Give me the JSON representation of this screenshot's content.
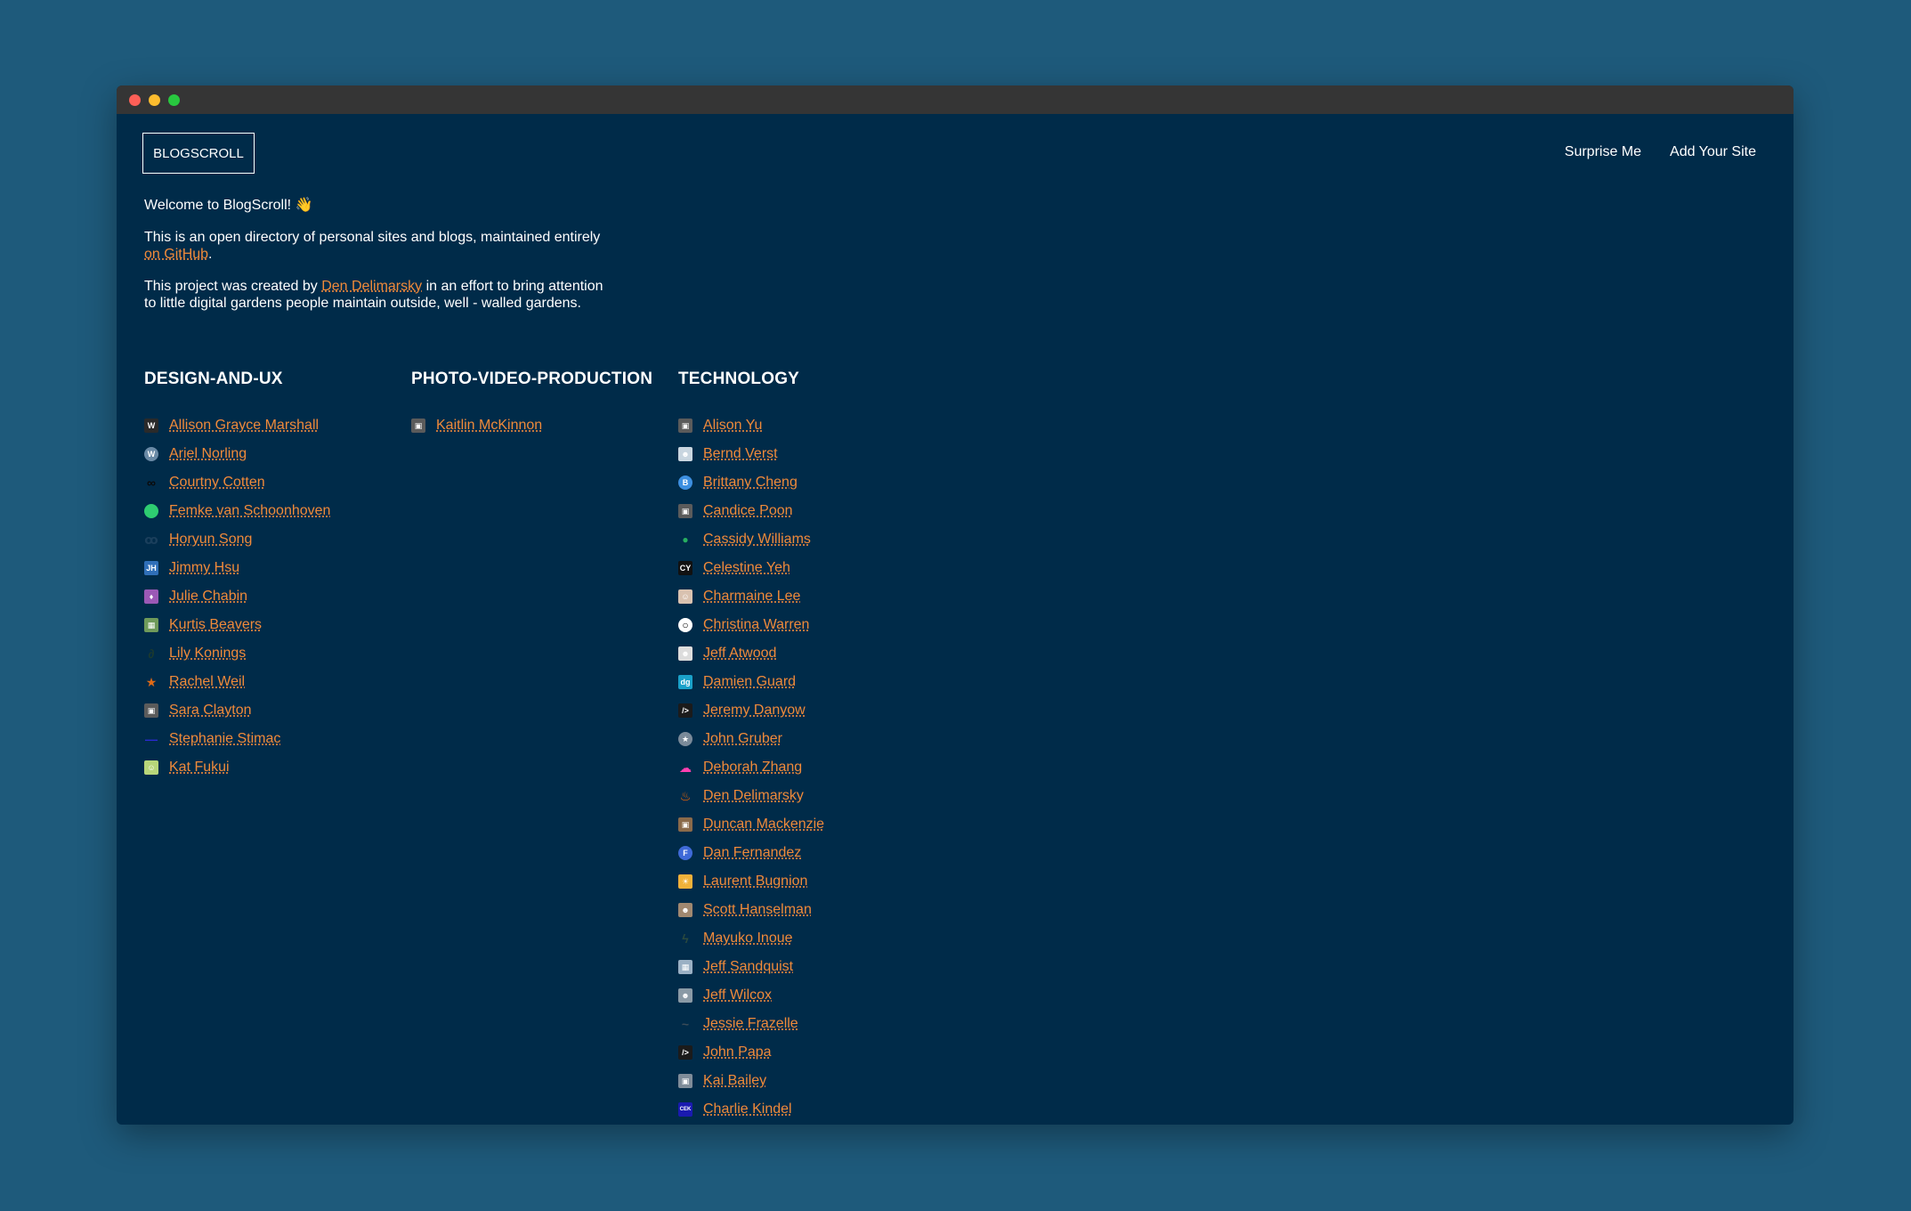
{
  "site": {
    "logo": "BLOGSCROLL",
    "nav": [
      {
        "label": "Surprise Me"
      },
      {
        "label": "Add Your Site"
      }
    ]
  },
  "intro": {
    "welcome": "Welcome to BlogScroll! 👋",
    "p1_text": "This is an open directory of personal sites and blogs, maintained entirely ",
    "p1_link": "on GitHub",
    "p1_end": ".",
    "p2_text": "This project was created by ",
    "p2_link": "Den Delimarsky",
    "p2_end": " in an effort to bring attention to little digital gardens people maintain outside, well - walled gardens."
  },
  "categories": [
    {
      "title": "DESIGN-AND-UX",
      "items": [
        {
          "name": "Allison Grayce Marshall",
          "icon": "w-letter-icon",
          "color": "#2a2a2a",
          "glyph": "W"
        },
        {
          "name": "Ariel Norling",
          "icon": "wordpress-icon",
          "color": "#6a8aa6",
          "glyph": "W"
        },
        {
          "name": "Courtny Cotten",
          "icon": "infinity-icon",
          "color": "#0a0a0a",
          "glyph": "∞"
        },
        {
          "name": "Femke van Schoonhoven",
          "icon": "green-circle-icon",
          "color": "#2ecc71",
          "glyph": ""
        },
        {
          "name": "Horyun Song",
          "icon": "link-glyph-icon",
          "color": "#1a3f5c",
          "glyph": "ꝏ"
        },
        {
          "name": "Jimmy Hsu",
          "icon": "jh-letters-icon",
          "color": "#2f6fb8",
          "glyph": "JH"
        },
        {
          "name": "Julie Chabin",
          "icon": "purple-flame-icon",
          "color": "#9b59b6",
          "glyph": "♦"
        },
        {
          "name": "Kurtis Beavers",
          "icon": "map-icon",
          "color": "#6f9a5a",
          "glyph": "▦"
        },
        {
          "name": "Lily Konings",
          "icon": "swirl-icon",
          "color": "#1c3a2e",
          "glyph": "∂"
        },
        {
          "name": "Rachel Weil",
          "icon": "star-icon",
          "color": "#e06a16",
          "glyph": "★"
        },
        {
          "name": "Sara Clayton",
          "icon": "cube-icon",
          "color": "#5b5b5b",
          "glyph": "▣"
        },
        {
          "name": "Stephanie Stimac",
          "icon": "blue-dash-icon",
          "color": "#2a2ad0",
          "glyph": "—"
        },
        {
          "name": "Kat Fukui",
          "icon": "smiley-icon",
          "color": "#b8d67a",
          "glyph": "☺"
        }
      ]
    },
    {
      "title": "PHOTO-VIDEO-PRODUCTION",
      "items": [
        {
          "name": "Kaitlin McKinnon",
          "icon": "cube-icon",
          "color": "#5b5b5b",
          "glyph": "▣"
        }
      ]
    },
    {
      "title": "TECHNOLOGY",
      "items": [
        {
          "name": "Alison Yu",
          "icon": "cube-icon",
          "color": "#5b5b5b",
          "glyph": "▣"
        },
        {
          "name": "Bernd Verst",
          "icon": "portrait-icon",
          "color": "#c9d6e0",
          "glyph": "☻"
        },
        {
          "name": "Brittany Cheng",
          "icon": "blue-b-icon",
          "color": "#3d8fe0",
          "glyph": "B"
        },
        {
          "name": "Candice Poon",
          "icon": "cube-icon",
          "color": "#5b5b5b",
          "glyph": "▣"
        },
        {
          "name": "Cassidy Williams",
          "icon": "green-dot-icon",
          "color": "#27ae60",
          "glyph": "●"
        },
        {
          "name": "Celestine Yeh",
          "icon": "cy-letters-icon",
          "color": "#111111",
          "glyph": "CY"
        },
        {
          "name": "Charmaine Lee",
          "icon": "people-icon",
          "color": "#d9c2b0",
          "glyph": "☺"
        },
        {
          "name": "Christina Warren",
          "icon": "ring-icon",
          "color": "#000000",
          "glyph": "○"
        },
        {
          "name": "Jeff Atwood",
          "icon": "portrait-icon",
          "color": "#dddddd",
          "glyph": "☻"
        },
        {
          "name": "Damien Guard",
          "icon": "dg-letters-icon",
          "color": "#1aa1c9",
          "glyph": "dg"
        },
        {
          "name": "Jeremy Danyow",
          "icon": "code-icon",
          "color": "#1b1b1b",
          "glyph": "/>"
        },
        {
          "name": "John Gruber",
          "icon": "star-badge-icon",
          "color": "#7a8a99",
          "glyph": "★"
        },
        {
          "name": "Deborah Zhang",
          "icon": "pink-cloud-icon",
          "color": "#ff3fb0",
          "glyph": "☁"
        },
        {
          "name": "Den Delimarsky",
          "icon": "fire-icon",
          "color": "#ff6a00",
          "glyph": "♨"
        },
        {
          "name": "Duncan Mackenzie",
          "icon": "photo-icon",
          "color": "#8a6a4a",
          "glyph": "▣"
        },
        {
          "name": "Dan Fernandez",
          "icon": "f-letter-icon",
          "color": "#3f6ad8",
          "glyph": "F"
        },
        {
          "name": "Laurent Bugnion",
          "icon": "sun-icon",
          "color": "#f0b13a",
          "glyph": "☀"
        },
        {
          "name": "Scott Hanselman",
          "icon": "face-icon",
          "color": "#a08870",
          "glyph": "☻"
        },
        {
          "name": "Mayuko Inoue",
          "icon": "leaf-icon",
          "color": "#2b4a3e",
          "glyph": "ϟ"
        },
        {
          "name": "Jeff Sandquist",
          "icon": "grid-icon",
          "color": "#9ab0c4",
          "glyph": "▦"
        },
        {
          "name": "Jeff Wilcox",
          "icon": "portrait-icon",
          "color": "#8a9aa6",
          "glyph": "☻"
        },
        {
          "name": "Jessie Frazelle",
          "icon": "feather-icon",
          "color": "#3c4c58",
          "glyph": "~"
        },
        {
          "name": "John Papa",
          "icon": "code-icon",
          "color": "#1b1b1b",
          "glyph": "/>"
        },
        {
          "name": "Kai Bailey",
          "icon": "photo-icon",
          "color": "#7f8c99",
          "glyph": "▣"
        },
        {
          "name": "Charlie Kindel",
          "icon": "cek-log-icon",
          "color": "#1a1ab0",
          "glyph": "CEK"
        }
      ]
    }
  ]
}
